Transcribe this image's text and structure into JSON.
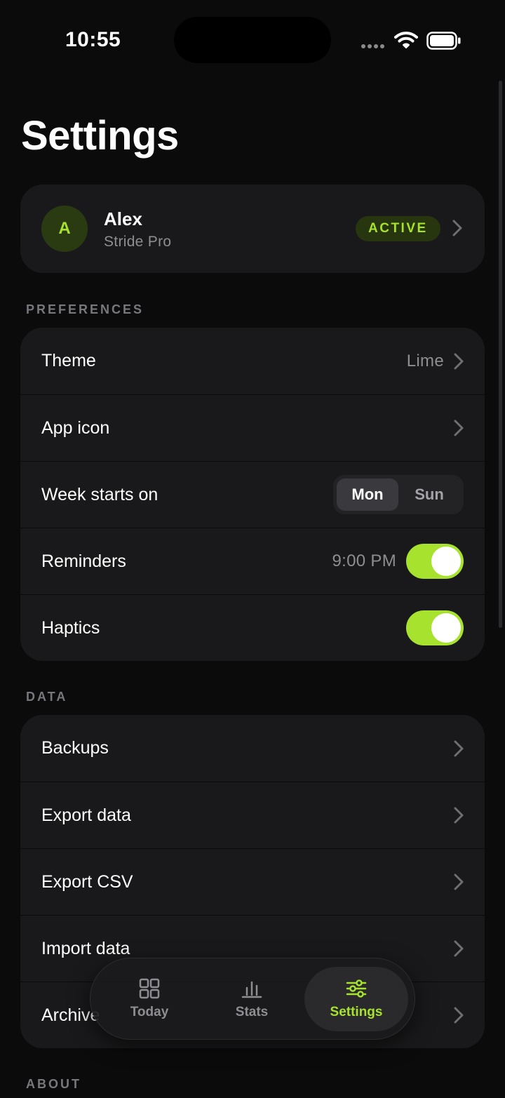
{
  "status_bar": {
    "time": "10:55"
  },
  "page": {
    "title": "Settings"
  },
  "profile": {
    "avatar_initial": "A",
    "name": "Alex",
    "plan": "Stride Pro",
    "badge": "ACTIVE"
  },
  "sections": {
    "preferences": {
      "label": "PREFERENCES",
      "theme": {
        "label": "Theme",
        "value": "Lime"
      },
      "app_icon": {
        "label": "App icon"
      },
      "week_start": {
        "label": "Week starts on",
        "options": [
          "Mon",
          "Sun"
        ],
        "selected": "Mon"
      },
      "reminders": {
        "label": "Reminders",
        "time": "9:00 PM",
        "enabled": true
      },
      "haptics": {
        "label": "Haptics",
        "enabled": true
      }
    },
    "data": {
      "label": "DATA",
      "items": [
        "Backups",
        "Export data",
        "Export CSV",
        "Import data",
        "Archive"
      ]
    },
    "about": {
      "label": "ABOUT"
    }
  },
  "tab_bar": {
    "tabs": [
      {
        "label": "Today",
        "icon": "grid-icon"
      },
      {
        "label": "Stats",
        "icon": "bar-chart-icon"
      },
      {
        "label": "Settings",
        "icon": "sliders-icon",
        "active": true
      }
    ]
  },
  "colors": {
    "accent": "#a6e22e",
    "background": "#0b0b0c",
    "card": "#19191b"
  }
}
